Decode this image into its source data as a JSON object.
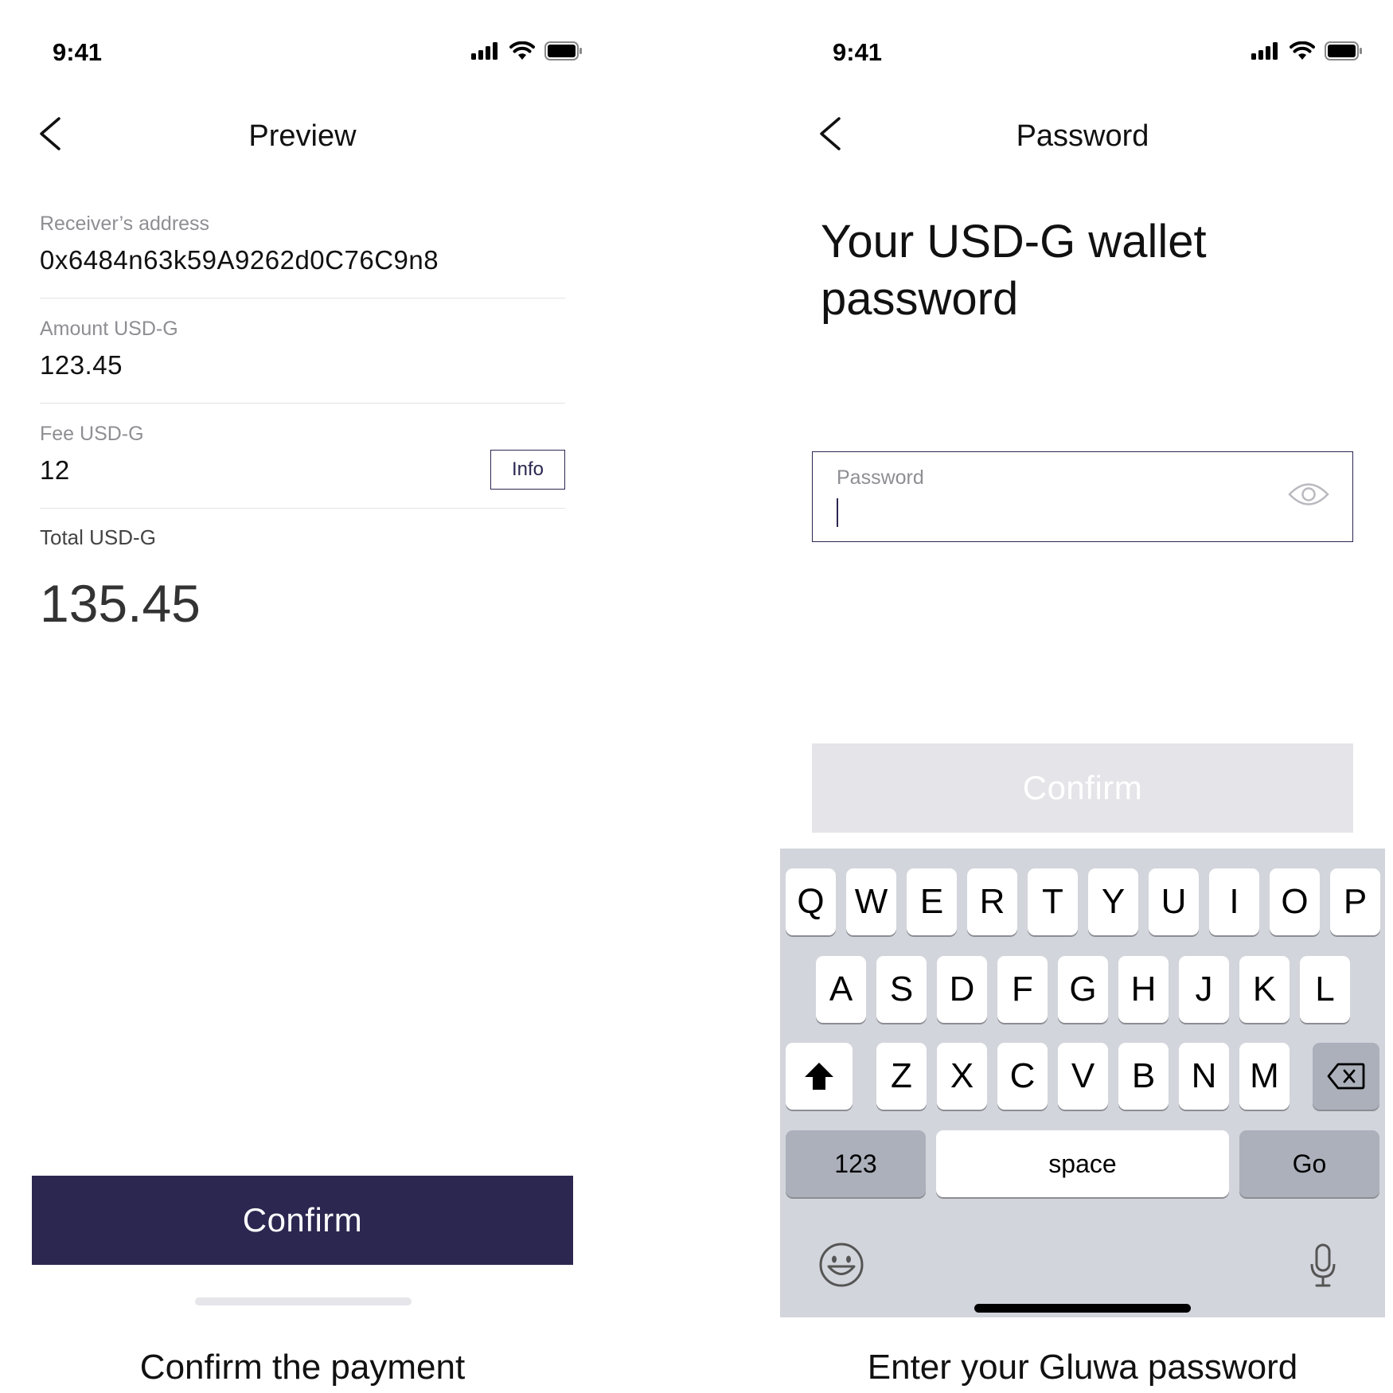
{
  "left": {
    "status_time": "9:41",
    "title": "Preview",
    "receiver": {
      "label": "Receiver’s address",
      "value": "0x6484n63k59A9262d0C76C9n8"
    },
    "amount": {
      "label": "Amount USD-G",
      "value": "123.45"
    },
    "fee": {
      "label": "Fee USD-G",
      "value": "12",
      "info_label": "Info"
    },
    "total": {
      "label": "Total USD-G",
      "value": "135.45"
    },
    "confirm_label": "Confirm",
    "caption": "Confirm the payment"
  },
  "right": {
    "status_time": "9:41",
    "title": "Password",
    "headline": "Your USD-G wallet password",
    "password_label": "Password",
    "password_value": "",
    "confirm_label": "Confirm",
    "confirm_enabled": false,
    "caption": "Enter your Gluwa password"
  },
  "keyboard": {
    "row1": [
      "Q",
      "W",
      "E",
      "R",
      "T",
      "Y",
      "U",
      "I",
      "O",
      "P"
    ],
    "row2": [
      "A",
      "S",
      "D",
      "F",
      "G",
      "H",
      "J",
      "K",
      "L"
    ],
    "row3": [
      "Z",
      "X",
      "C",
      "V",
      "B",
      "N",
      "M"
    ],
    "numbers_label": "123",
    "space_label": "space",
    "go_label": "Go"
  },
  "icons": {
    "status": [
      "cellular-signal-icon",
      "wifi-icon",
      "battery-icon"
    ],
    "nav": "chevron-left-icon",
    "password_field": "eye-icon",
    "keyboard": [
      "shift-icon",
      "backspace-icon",
      "emoji-icon",
      "microphone-icon"
    ]
  },
  "colors": {
    "brand": "#2b2750",
    "disabled_button": "#e4e4e9",
    "keyboard_bg": "#d2d5db",
    "special_key": "#abb0bb",
    "label_gray": "#8e8e93"
  }
}
